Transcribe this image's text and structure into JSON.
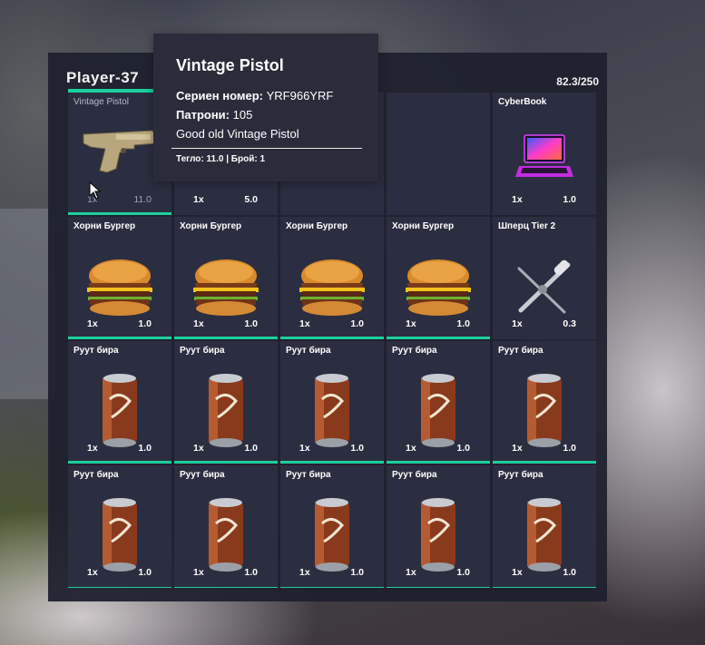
{
  "player": {
    "name": "Player-37",
    "weight": "82.3/250"
  },
  "colors": {
    "accent": "#1ccf9f",
    "panel": "#1e202e",
    "slot": "#2b2e40"
  },
  "slots": [
    {
      "name": "Vintage Pistol",
      "count": "1x",
      "weight": "11.0",
      "icon": "pistol-icon"
    },
    {
      "name": "",
      "count": "1x",
      "weight": "5.0",
      "icon": ""
    },
    {
      "name": "",
      "count": "",
      "weight": "",
      "icon": ""
    },
    {
      "name": "",
      "count": "",
      "weight": "",
      "icon": ""
    },
    {
      "name": "CyberBook",
      "count": "1x",
      "weight": "1.0",
      "icon": "laptop-icon"
    },
    {
      "name": "Хорни Бургер",
      "count": "1x",
      "weight": "1.0",
      "icon": "burger-icon"
    },
    {
      "name": "Хорни Бургер",
      "count": "1x",
      "weight": "1.0",
      "icon": "burger-icon"
    },
    {
      "name": "Хорни Бургер",
      "count": "1x",
      "weight": "1.0",
      "icon": "burger-icon"
    },
    {
      "name": "Хорни Бургер",
      "count": "1x",
      "weight": "1.0",
      "icon": "burger-icon"
    },
    {
      "name": "Шперц Tier 2",
      "count": "1x",
      "weight": "0.3",
      "icon": "lockpick-icon"
    },
    {
      "name": "Руут бира",
      "count": "1x",
      "weight": "1.0",
      "icon": "can-icon"
    },
    {
      "name": "Руут бира",
      "count": "1x",
      "weight": "1.0",
      "icon": "can-icon"
    },
    {
      "name": "Руут бира",
      "count": "1x",
      "weight": "1.0",
      "icon": "can-icon"
    },
    {
      "name": "Руут бира",
      "count": "1x",
      "weight": "1.0",
      "icon": "can-icon"
    },
    {
      "name": "Руут бира",
      "count": "1x",
      "weight": "1.0",
      "icon": "can-icon"
    },
    {
      "name": "Руут бира",
      "count": "1x",
      "weight": "1.0",
      "icon": "can-icon"
    },
    {
      "name": "Руут бира",
      "count": "1x",
      "weight": "1.0",
      "icon": "can-icon"
    },
    {
      "name": "Руут бира",
      "count": "1x",
      "weight": "1.0",
      "icon": "can-icon"
    },
    {
      "name": "Руут бира",
      "count": "1x",
      "weight": "1.0",
      "icon": "can-icon"
    },
    {
      "name": "Руут бира",
      "count": "1x",
      "weight": "1.0",
      "icon": "can-icon"
    }
  ],
  "tooltip": {
    "title": "Vintage Pistol",
    "serial_label": "Сериен номер:",
    "serial_value": "YRF966YRF",
    "ammo_label": "Патрони:",
    "ammo_value": "105",
    "description": "Good old Vintage Pistol",
    "footer": "Тегло: 11.0 | Брой: 1"
  }
}
